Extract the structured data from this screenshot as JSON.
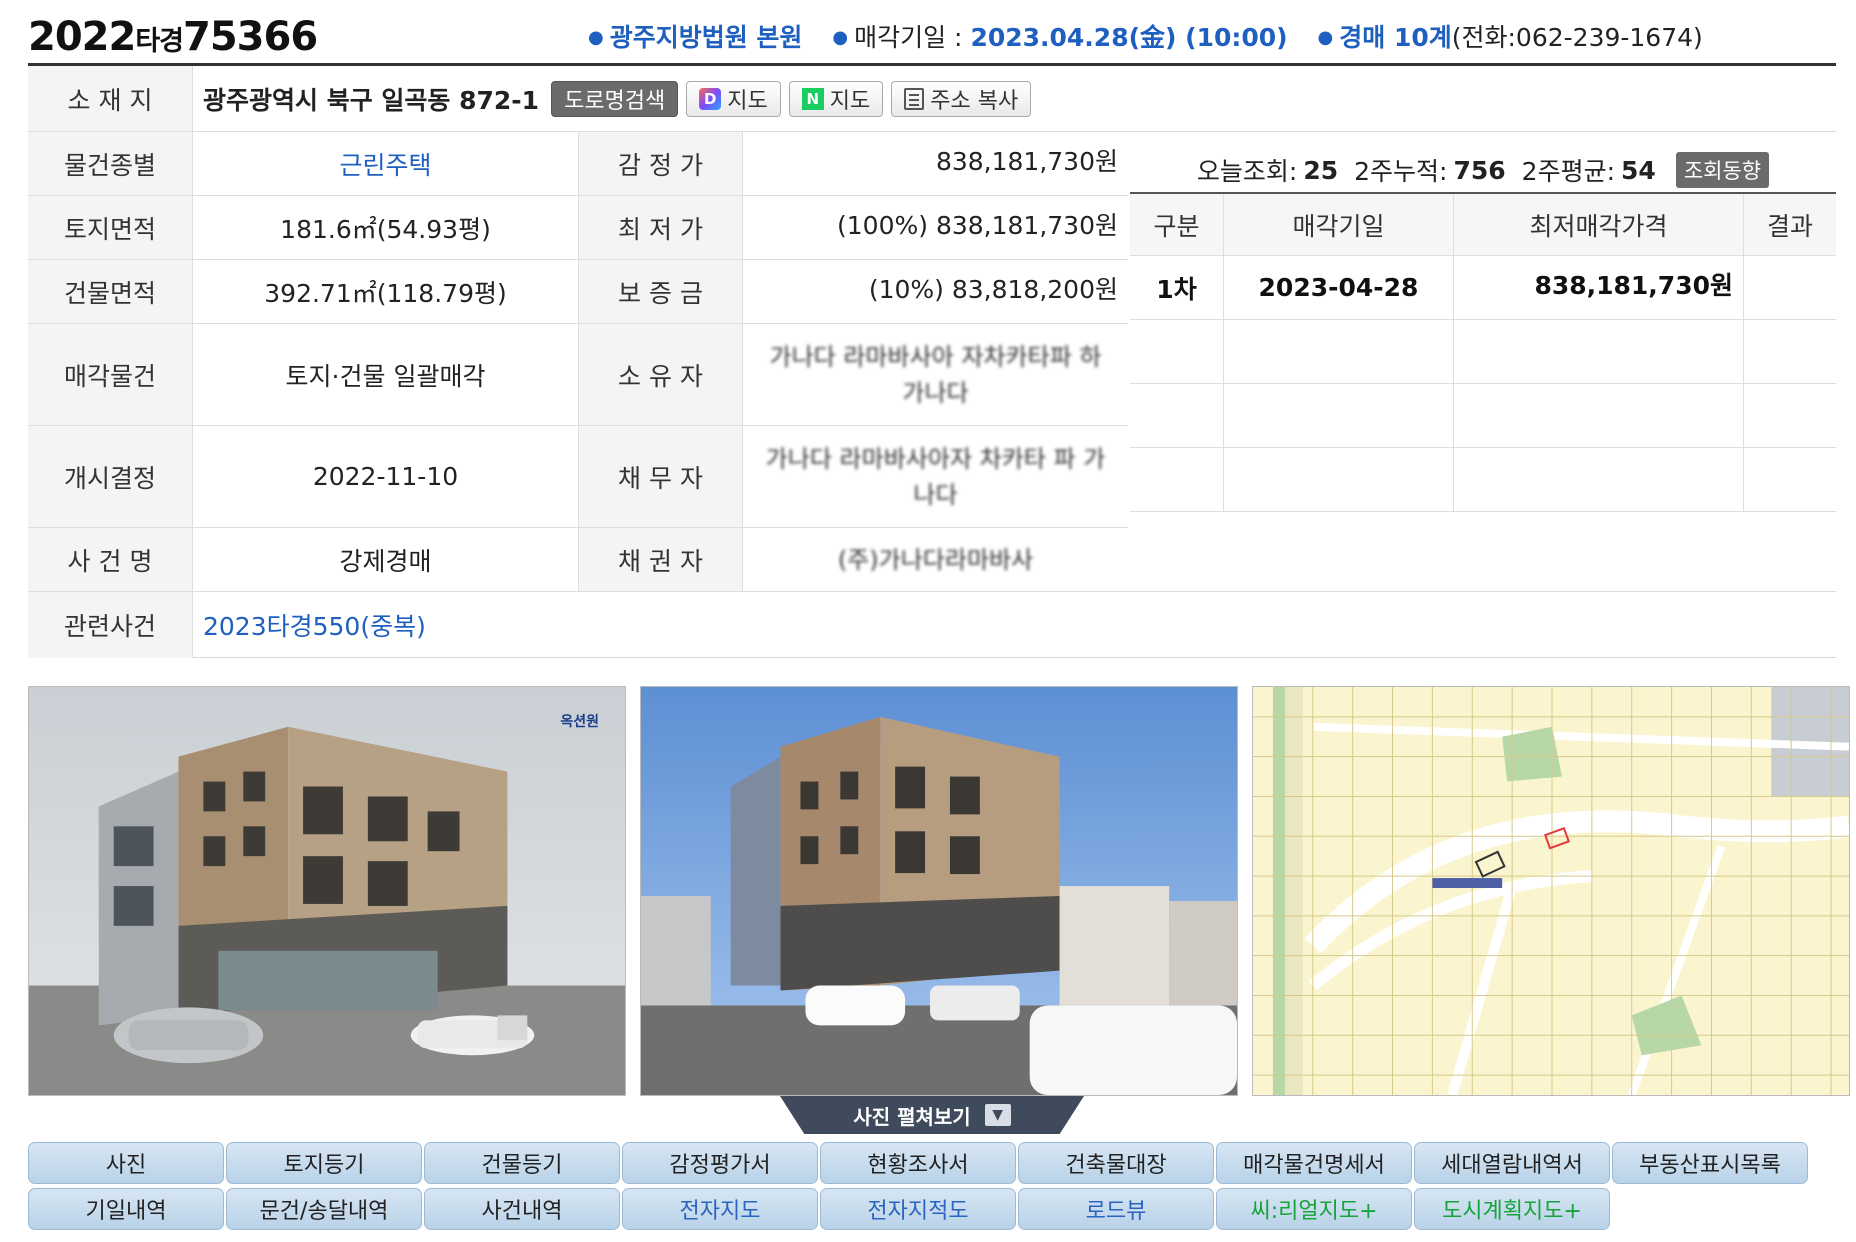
{
  "header": {
    "case_year": "2022",
    "case_type": "타경",
    "case_num": "75366",
    "court": "광주지방법원 본원",
    "sale_date_label": "매각기일 : ",
    "sale_date": "2023.04.28(金) (10:00)",
    "dept": "경매 10계",
    "phone": "(전화:062-239-1674)"
  },
  "location": {
    "label": "소 재 지",
    "address": "광주광역시 북구 일곡동 872-1",
    "btn_road": "도로명검색",
    "btn_daum_icon": "D",
    "btn_daum": "지도",
    "btn_naver_icon": "N",
    "btn_naver": "지도",
    "btn_copy": "주소 복사"
  },
  "property": {
    "type_label": "물건종별",
    "type_value": "근린주택",
    "land_label": "토지면적",
    "land_value": "181.6㎡(54.93평)",
    "bldg_label": "건물면적",
    "bldg_value": "392.71㎡(118.79평)",
    "sale_label": "매각물건",
    "sale_value": "토지·건물 일괄매각",
    "start_label": "개시결정",
    "start_value": "2022-11-10",
    "case_label": "사 건 명",
    "case_value": "강제경매",
    "related_label": "관련사건",
    "related_value": "2023타경550(중복)"
  },
  "prices": {
    "appraisal_label": "감 정 가",
    "appraisal_value": "838,181,730원",
    "minimum_label": "최 저 가",
    "minimum_value": "(100%) 838,181,730원",
    "deposit_label": "보 증 금",
    "deposit_value": "(10%) 83,818,200원",
    "owner_label": "소 유 자",
    "owner_value": "가나다 라마바사아 자차카타파 하 가나다",
    "debtor_label": "채 무 자",
    "debtor_value": "가나다 라마바사아자 차카타 파 가나다",
    "creditor_label": "채 권 자",
    "creditor_value": "(주)가나다라마바사"
  },
  "stats": {
    "today_label": "오늘조회:",
    "today_value": "25",
    "week2_label": "2주누적:",
    "week2_value": "756",
    "avg_label": "2주평균:",
    "avg_value": "54",
    "trend_btn": "조회동향"
  },
  "schedule": {
    "headers": [
      "구분",
      "매각기일",
      "최저매각가격",
      "결과"
    ],
    "rows": [
      {
        "round": "1차",
        "date": "2023-04-28",
        "price": "838,181,730원",
        "result": ""
      }
    ]
  },
  "photos": {
    "watermark": "옥션원",
    "expand_label": "사진 펼쳐보기",
    "expand_icon": "chevron-down"
  },
  "tabs": {
    "row1": [
      "사진",
      "토지등기",
      "건물등기",
      "감정평가서",
      "현황조사서",
      "건축물대장",
      "매각물건명세서",
      "세대열람내역서",
      "부동산표시목록"
    ],
    "row2": [
      "기일내역",
      "문건/송달내역",
      "사건내역",
      "전자지도",
      "전자지적도",
      "로드뷰",
      "씨:리얼지도+",
      "도시계획지도+"
    ]
  },
  "colors": {
    "link_blue": "#1f5fbf",
    "tab_bg": "#c6dbee",
    "green_text": "#16a33a",
    "header_bar": "#3f4a5c"
  }
}
